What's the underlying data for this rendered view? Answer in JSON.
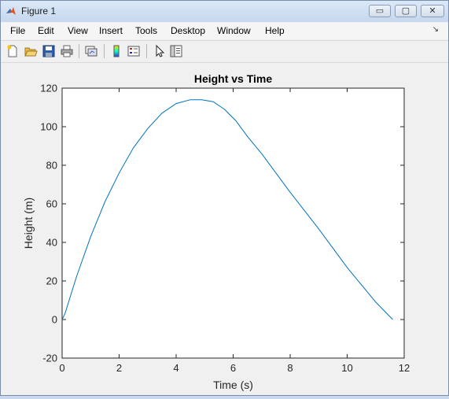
{
  "window": {
    "title": "Figure 1"
  },
  "window_controls": {
    "minimize": "▭",
    "maximize": "▢",
    "close": "✕"
  },
  "menu": {
    "items": [
      "File",
      "Edit",
      "View",
      "Insert",
      "Tools",
      "Desktop",
      "Window",
      "Help"
    ],
    "overflow_icon": "dock-arrow-icon"
  },
  "toolbar": {
    "icons": [
      "new-figure-icon",
      "open-file-icon",
      "save-icon",
      "print-icon",
      "link-plot-icon",
      "insert-colorbar-icon",
      "insert-legend-icon",
      "edit-plot-icon",
      "property-editor-icon"
    ]
  },
  "colors": {
    "line": "#0072bd",
    "background": "#f0f0f0",
    "axes": "#ffffff"
  },
  "chart_data": {
    "type": "line",
    "title": "Height vs Time",
    "xlabel": "Time (s)",
    "ylabel": "Height (m)",
    "xlim": [
      0,
      12
    ],
    "ylim": [
      -20,
      120
    ],
    "xticks": [
      0,
      2,
      4,
      6,
      8,
      10,
      12
    ],
    "yticks": [
      -20,
      0,
      20,
      40,
      60,
      80,
      100,
      120
    ],
    "grid": false,
    "series": [
      {
        "x": [
          0,
          0.1,
          0.5,
          1,
          1.5,
          2,
          2.5,
          3,
          3.5,
          4,
          4.5,
          4.9,
          5.3,
          5.7,
          6.1,
          6.5,
          7,
          8,
          9,
          10,
          11,
          11.6
        ],
        "y": [
          0,
          3,
          22,
          43,
          61,
          76,
          89,
          99,
          107,
          112,
          114,
          114,
          113,
          109,
          103,
          95,
          86,
          66,
          47,
          27,
          9,
          0
        ]
      }
    ]
  }
}
